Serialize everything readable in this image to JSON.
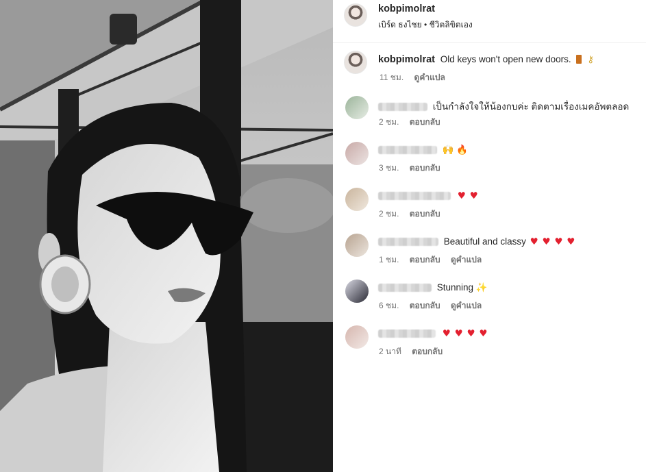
{
  "post": {
    "author": "kobpimolrat",
    "subline_parts": [
      "เบิร์ด ธงไชย",
      "•",
      "ชีวิตลิขิตเอง"
    ],
    "caption": {
      "handle": "kobpimolrat",
      "text": "Old keys won't open new doors.",
      "icons": [
        "door-icon",
        "key-icon"
      ],
      "time": "11 ชม.",
      "translate": "ดูคำแปล"
    }
  },
  "comments": [
    {
      "text": "เป็นกำลังใจให้น้องกบค่ะ ติดตามเรื่องเมคอัพตลอด",
      "emojis": [],
      "time": "2 ชม.",
      "reply": "ตอบกลับ",
      "translate": ""
    },
    {
      "text": "",
      "emojis": [
        "🙌",
        "🔥"
      ],
      "time": "3 ชม.",
      "reply": "ตอบกลับ",
      "translate": ""
    },
    {
      "text": "",
      "emojis": [
        "♥",
        "♥"
      ],
      "time": "2 ชม.",
      "reply": "ตอบกลับ",
      "translate": ""
    },
    {
      "text": "Beautiful and classy",
      "emojis": [
        "♥",
        "♥",
        "♥",
        "♥"
      ],
      "time": "1 ชม.",
      "reply": "ตอบกลับ",
      "translate": "ดูคำแปล"
    },
    {
      "text": "Stunning",
      "emojis": [
        "✨"
      ],
      "time": "6 ชม.",
      "reply": "ตอบกลับ",
      "translate": "ดูคำแปล"
    },
    {
      "text": "",
      "emojis": [
        "♥",
        "♥",
        "♥",
        "♥"
      ],
      "time": "2 นาที",
      "reply": "ตอบกลับ",
      "translate": ""
    }
  ],
  "colors": {
    "heart": "#e3202f",
    "text": "#262626",
    "muted": "#737373"
  }
}
